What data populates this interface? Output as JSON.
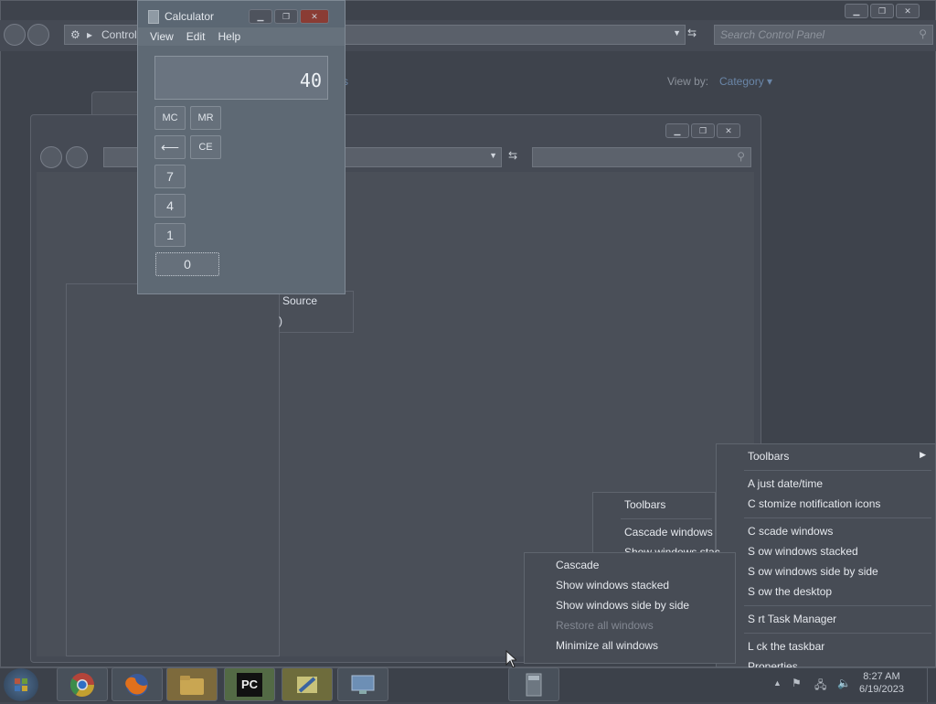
{
  "control_panel": {
    "address": "Control",
    "address_tail": "s",
    "search_placeholder": "Search Control Panel",
    "view_by_label": "View by:",
    "view_by_value": "Category",
    "link_fragment": "s"
  },
  "explorer2": {
    "source_label": "Source",
    "source_value": ")"
  },
  "calculator": {
    "title": "Calculator",
    "menu": [
      "View",
      "Edit",
      "Help"
    ],
    "display": "40",
    "buttons": {
      "mc": "MC",
      "mr": "MR",
      "back": "⟵",
      "ce": "CE",
      "seven": "7",
      "four": "4",
      "one": "1",
      "zero": "0"
    }
  },
  "taskbar_menu": {
    "toolbars": "Toolbars",
    "adjust": "A just date/time",
    "customize": "C stomize notification icons",
    "cascade": "C scade windows",
    "stacked": "S ow windows stacked",
    "side": "S ow windows side by side",
    "desktop": "S ow the desktop",
    "task_manager": "S rt Task Manager",
    "lock": "L ck the taskbar",
    "properties": "Properties"
  },
  "mid_menu": {
    "toolbars": "Toolbars",
    "cascade": "Cascade windows",
    "stacked": "Show windows stac"
  },
  "front_menu": {
    "cascade": "Cascade",
    "stacked": "Show windows stacked",
    "side": "Show windows side by side",
    "restore": "Restore all windows",
    "minimize": "Minimize all windows"
  },
  "tray": {
    "time": "8:27 AM",
    "date": "6/19/2023",
    "pc_label": "PC"
  },
  "colors": {
    "accent": "#c94a3c",
    "chrome": "#2f6fc4",
    "firefox": "#e0701c"
  }
}
